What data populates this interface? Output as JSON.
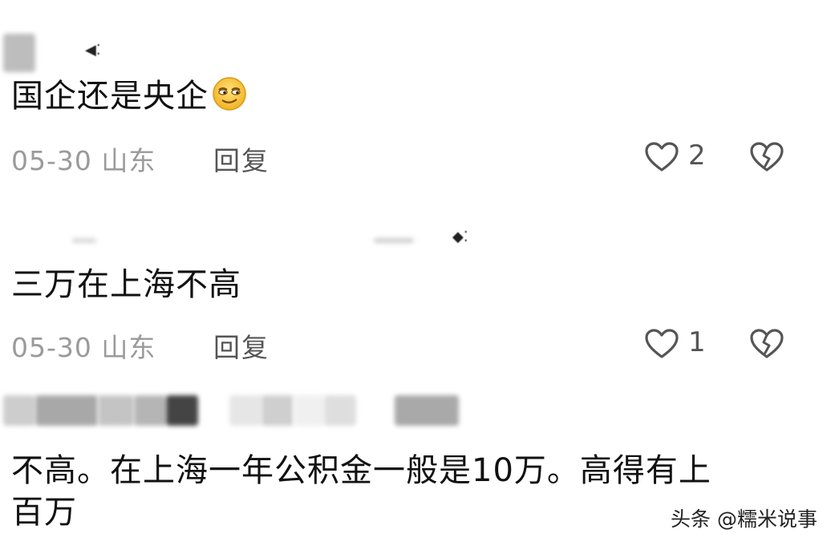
{
  "comments": [
    {
      "text": "国企还是央企",
      "emoji": "smirk-emoji",
      "date_location": "05-30 山东",
      "reply_label": "回复",
      "like_count": "2"
    },
    {
      "text": "三万在上海不高",
      "date_location": "05-30 山东",
      "reply_label": "回复",
      "like_count": "1"
    },
    {
      "text_line1": "不高。在上海一年公积金一般是10万。高得有上",
      "text_line2": "百万"
    }
  ],
  "watermark": "头条 @糯米说事",
  "colors": {
    "text": "#111111",
    "meta": "#9a9a9a",
    "reply": "#555555",
    "icon": "#555555"
  },
  "icons": [
    "heart-outline-icon",
    "broken-heart-icon"
  ]
}
